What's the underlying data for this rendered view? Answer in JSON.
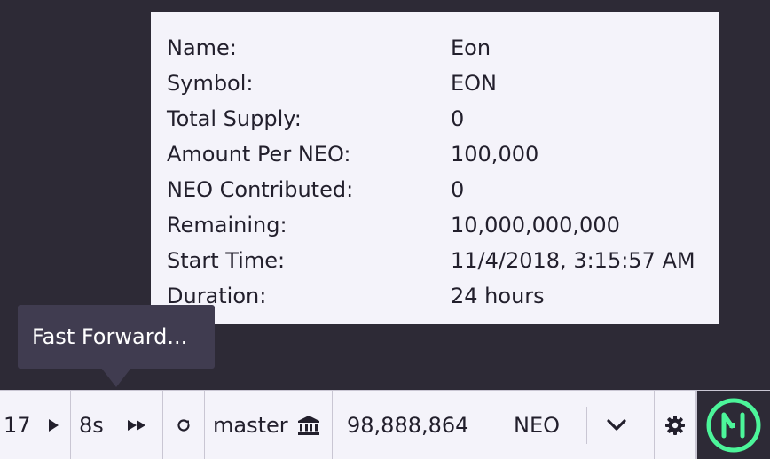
{
  "token_info": {
    "rows": [
      {
        "label": "Name:",
        "value": "Eon"
      },
      {
        "label": "Symbol:",
        "value": "EON"
      },
      {
        "label": "Total Supply:",
        "value": "0"
      },
      {
        "label": "Amount Per NEO:",
        "value": "100,000"
      },
      {
        "label": "NEO Contributed:",
        "value": "0"
      },
      {
        "label": "Remaining:",
        "value": "10,000,000,000"
      },
      {
        "label": "Start Time:",
        "value": "11/4/2018, 3:15:57 AM"
      },
      {
        "label": "Duration:",
        "value": "24 hours"
      }
    ]
  },
  "tooltip": {
    "text": "Fast Forward..."
  },
  "toolbar": {
    "block_number": "17",
    "speed": "8s",
    "network": "master",
    "balance_amount": "98,888,864",
    "balance_asset": "NEO",
    "icons": {
      "play": "play-icon",
      "fast_forward": "fast-forward-icon",
      "refresh": "refresh-icon",
      "network": "bank-icon",
      "dropdown": "chevron-down-icon",
      "settings": "gear-icon",
      "logo": "neo-one-logo"
    }
  },
  "colors": {
    "background": "#2d2a36",
    "panel": "#f4f3fa",
    "text": "#221f2c",
    "tooltip": "#403c50",
    "logo_green": "#4cf59a",
    "border": "#c9c6d3"
  }
}
